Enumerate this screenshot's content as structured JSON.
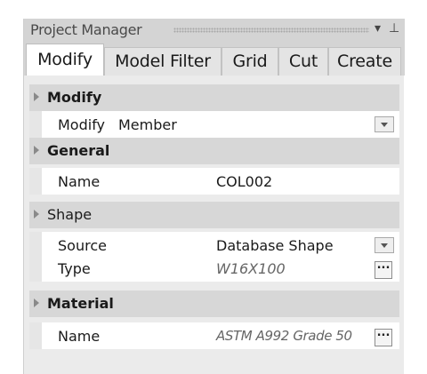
{
  "window": {
    "title": "Project Manager",
    "pin_glyph": "▾ ⊥"
  },
  "tabs": [
    {
      "label": "Modify",
      "active": true
    },
    {
      "label": "Model Filter",
      "active": false
    },
    {
      "label": "Grid",
      "active": false
    },
    {
      "label": "Cut",
      "active": false
    },
    {
      "label": "Create",
      "active": false
    }
  ],
  "categories": {
    "modify": "Modify",
    "general": "General",
    "shape": "Shape",
    "material": "Material"
  },
  "properties": {
    "modify_label": "Modify",
    "modify_value": "Member",
    "general_name_label": "Name",
    "general_name_value": "COL002",
    "source_label": "Source",
    "source_value": "Database Shape",
    "type_label": "Type",
    "type_value": "W16X100",
    "material_name_label": "Name",
    "material_name_value": "ASTM A992 Grade 50"
  },
  "ellipsis": "...",
  "icons": {
    "collapse": "triangle-right-icon",
    "dropdown": "chevron-down-icon",
    "pin": "pin-icon",
    "menu": "dropdown-menu-icon"
  }
}
